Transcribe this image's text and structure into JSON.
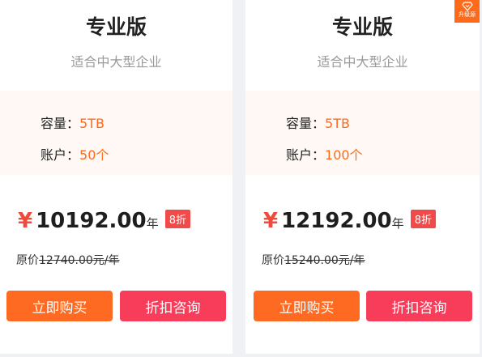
{
  "plans": [
    {
      "title": "专业版",
      "subtitle": "适合中大型企业",
      "specs": [
        {
          "label": "容量：",
          "value": "5TB"
        },
        {
          "label": "账户：",
          "value": "50个"
        }
      ],
      "currency": "¥",
      "price": "10192.00",
      "unit": "年",
      "discount": "8折",
      "original_label": "原价",
      "original_value": "12740.00元/年",
      "buy_label": "立即购买",
      "consult_label": "折扣咨询"
    },
    {
      "title": "专业版",
      "subtitle": "适合中大型企业",
      "specs": [
        {
          "label": "容量：",
          "value": "5TB"
        },
        {
          "label": "账户：",
          "value": "100个"
        }
      ],
      "currency": "¥",
      "price": "12192.00",
      "unit": "年",
      "discount": "8折",
      "original_label": "原价",
      "original_value": "15240.00元/年",
      "buy_label": "立即购买",
      "consult_label": "折扣咨询",
      "badge": "升级源"
    }
  ],
  "colors": {
    "accent_orange": "#ff6a22",
    "consult_red": "#f73d5a",
    "discount_red": "#f04a4a",
    "spec_value": "#ff6a1a"
  },
  "icons": {
    "badge_icon": "diamond-heart-icon"
  }
}
